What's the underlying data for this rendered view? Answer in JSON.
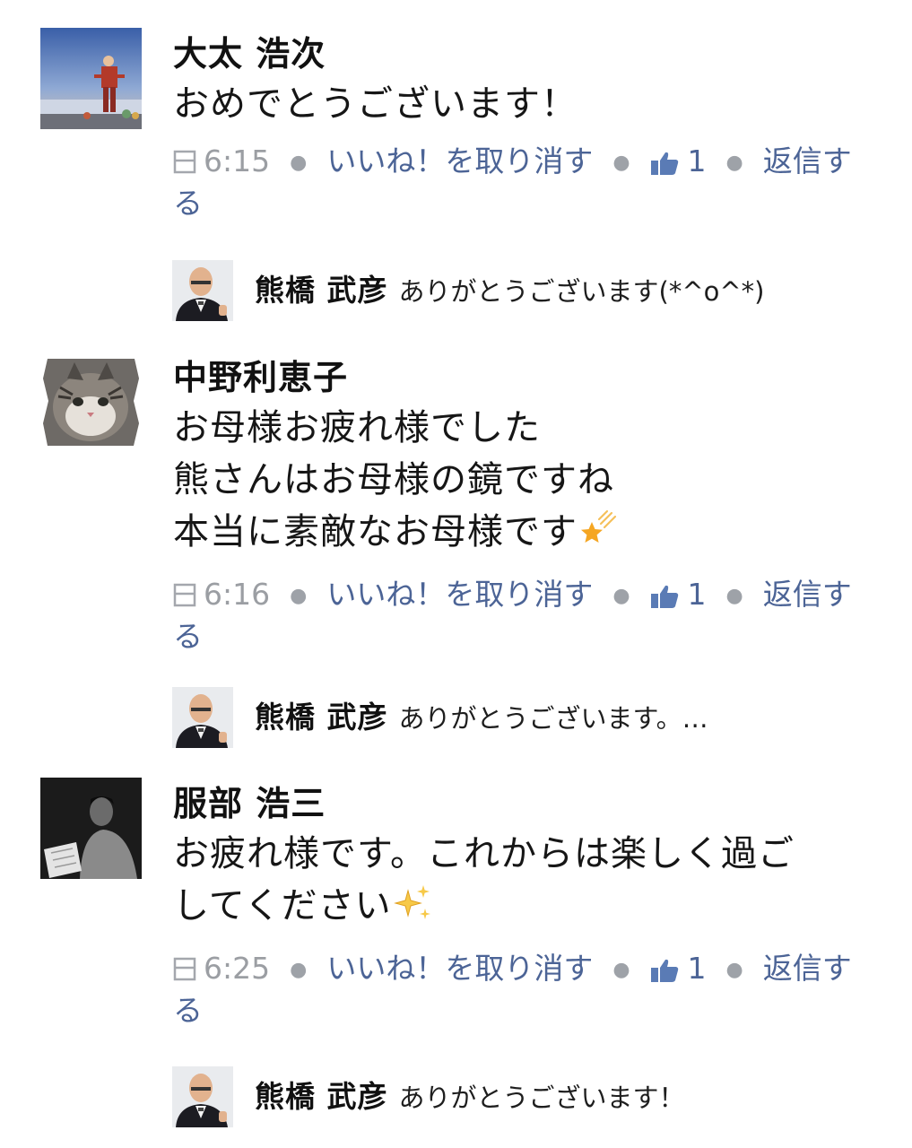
{
  "comments": [
    {
      "author": "大太 浩次",
      "lines": [
        "おめでとうございます！"
      ],
      "time": "6:15",
      "unlike": "いいね！を取り消す",
      "likes": "1",
      "reply_label_a": "返信す",
      "reply_label_b": "る",
      "avatar_icon": "mountain-climber-photo",
      "reply": {
        "name": "熊橋 武彦",
        "text": "ありがとうございます(*^o^*)"
      }
    },
    {
      "author": "中野利恵子",
      "lines": [
        "お母様お疲れ様でした",
        "熊さんはお母様の鏡ですね",
        "本当に素敵なお母様です"
      ],
      "emoji": "shooting-star-icon",
      "time": "6:16",
      "unlike": "いいね！を取り消す",
      "likes": "1",
      "reply_label_a": "返信す",
      "reply_label_b": "る",
      "avatar_icon": "cat-photo",
      "reply": {
        "name": "熊橋 武彦",
        "text": "ありがとうございます。…"
      }
    },
    {
      "author": "服部 浩三",
      "lines": [
        "お疲れ様です。これからは楽しく過ご",
        "してください"
      ],
      "emoji": "sparkles-icon",
      "time": "6:25",
      "unlike": "いいね！を取り消す",
      "likes": "1",
      "reply_label_a": "返信す",
      "reply_label_b": "る",
      "avatar_icon": "man-reading-photo",
      "reply": {
        "name": "熊橋 武彦",
        "text": "ありがとうございます！"
      }
    }
  ],
  "colors": {
    "link": "#4c6496",
    "meta": "#9b9ea3",
    "star": "#f5a623"
  }
}
